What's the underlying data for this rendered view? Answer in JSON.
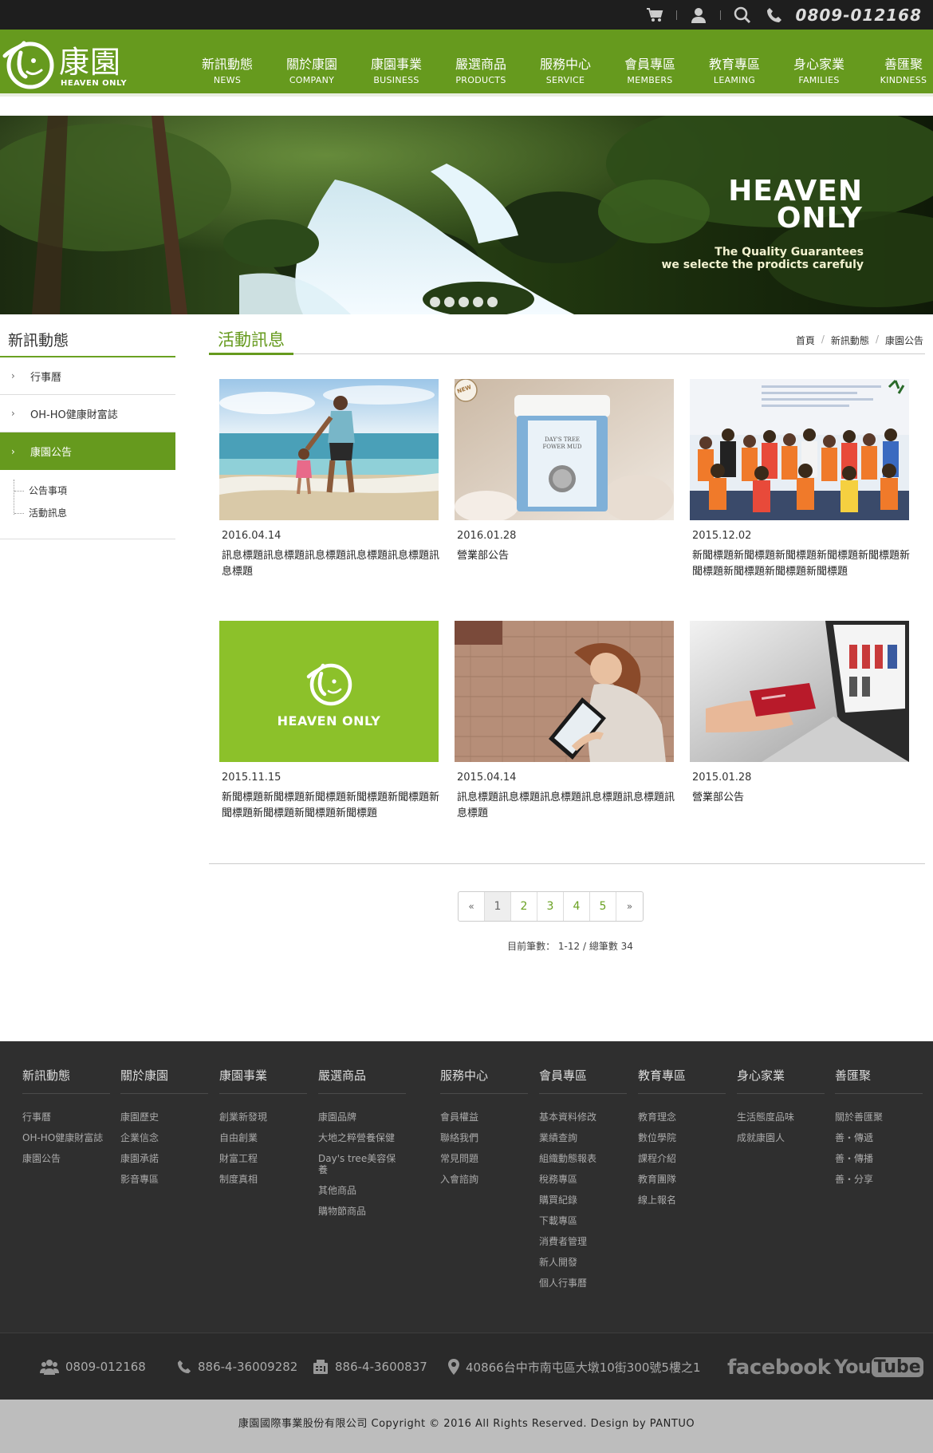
{
  "topbar": {
    "phone": "0809-012168",
    "icons": [
      "cart-icon",
      "user-icon",
      "search-icon",
      "phone-icon"
    ]
  },
  "logo": {
    "cn": "康園",
    "en": "HEAVEN ONLY"
  },
  "nav": [
    {
      "zh": "新訊動態",
      "en": "NEWS"
    },
    {
      "zh": "關於康園",
      "en": "COMPANY"
    },
    {
      "zh": "康園事業",
      "en": "BUSINESS"
    },
    {
      "zh": "嚴選商品",
      "en": "PRODUCTS"
    },
    {
      "zh": "服務中心",
      "en": "SERVICE"
    },
    {
      "zh": "會員專區",
      "en": "MEMBERS"
    },
    {
      "zh": "教育專區",
      "en": "LEAMING"
    },
    {
      "zh": "身心家業",
      "en": "FAMILIES"
    },
    {
      "zh": "善匯聚",
      "en": "KINDNESS"
    }
  ],
  "banner": {
    "line1": "HEAVEN",
    "line2": "ONLY",
    "sub1": "The Quality Guarantees",
    "sub2": "we selecte the prodicts carefuly",
    "slides": 5
  },
  "sidebar": {
    "title": "新訊動態",
    "items": [
      "行事曆",
      "OH-HO健康財富誌",
      "康園公告"
    ],
    "sub": [
      "公告事項",
      "活動訊息"
    ]
  },
  "main": {
    "title": "活動訊息",
    "breadcrumb": [
      "首頁",
      "新訊動態",
      "康園公告"
    ]
  },
  "cards": [
    {
      "date": "2016.04.14",
      "title": "訊息標題訊息標題訊息標題訊息標題訊息標題訊息標題",
      "thumb": "beach"
    },
    {
      "date": "2016.01.28",
      "title": "營業部公告",
      "thumb": "jar"
    },
    {
      "date": "2015.12.02",
      "title": "新聞標題新聞標題新聞標題新聞標題新聞標題新聞標題新聞標題新聞標題新聞標題",
      "thumb": "crowd"
    },
    {
      "date": "2015.11.15",
      "title": "新聞標題新聞標題新聞標題新聞標題新聞標題新聞標題新聞標題新聞標題新聞標題",
      "thumb": "logo"
    },
    {
      "date": "2015.04.14",
      "title": "訊息標題訊息標題訊息標題訊息標題訊息標題訊息標題",
      "thumb": "tablet"
    },
    {
      "date": "2015.01.28",
      "title": "營業部公告",
      "thumb": "card"
    }
  ],
  "card_logo_text": "HEAVEN ONLY",
  "card_jar_label": "DAY'S TREE\nFOWER MUD",
  "card_new_badge": "NEW",
  "pager": {
    "prev": "«",
    "pages": [
      "1",
      "2",
      "3",
      "4",
      "5"
    ],
    "next": "»",
    "current": "1"
  },
  "record_text": "目前筆數： 1-12 / 總筆數 34",
  "footer": {
    "columns": [
      {
        "title": "新訊動態",
        "links": [
          "行事曆",
          "OH-HO健康財富誌",
          "康園公告"
        ]
      },
      {
        "title": "關於康園",
        "links": [
          "康園歷史",
          "企業信念",
          "康園承諾",
          "影音專區"
        ]
      },
      {
        "title": "康園事業",
        "links": [
          "創業新發現",
          "自由創業",
          "財富工程",
          "制度真相"
        ]
      },
      {
        "title": "嚴選商品",
        "links": [
          "康園品牌",
          "大地之粹營養保健",
          "Day's tree美容保養",
          "其他商品",
          "購物節商品"
        ]
      },
      {
        "title": "服務中心",
        "links": [
          "會員權益",
          "聯絡我們",
          "常見問題",
          "入會諮詢"
        ]
      },
      {
        "title": "會員專區",
        "links": [
          "基本資料修改",
          "業績查詢",
          "組織動態報表",
          "稅務專區",
          "購買紀錄",
          "下載專區",
          "消費者管理",
          "新人開發",
          "個人行事曆"
        ]
      },
      {
        "title": "教育專區",
        "links": [
          "教育理念",
          "數位學院",
          "課程介紹",
          "教育團隊",
          "線上報名"
        ]
      },
      {
        "title": "身心家業",
        "links": [
          "生活態度品味",
          "成就康園人"
        ]
      },
      {
        "title": "善匯聚",
        "links": [
          "關於善匯聚",
          "善・傳遞",
          "善・傳播",
          "善・分享"
        ]
      }
    ]
  },
  "contact": {
    "members_phone": "0809-012168",
    "tel": "886-4-36009282",
    "fax": "886-4-3600837",
    "address": "40866台中市南屯區大墩10街300號5樓之1",
    "facebook": "facebook",
    "youtube_you": "You",
    "youtube_tube": "Tube"
  },
  "copyright": "康園國際事業股份有限公司  Copyright © 2016 All Rights Reserved.   Design by PANTUO",
  "colors": {
    "brand_green": "#669a1e",
    "dark": "#1e1e1e",
    "footer": "#2f2f2f"
  }
}
